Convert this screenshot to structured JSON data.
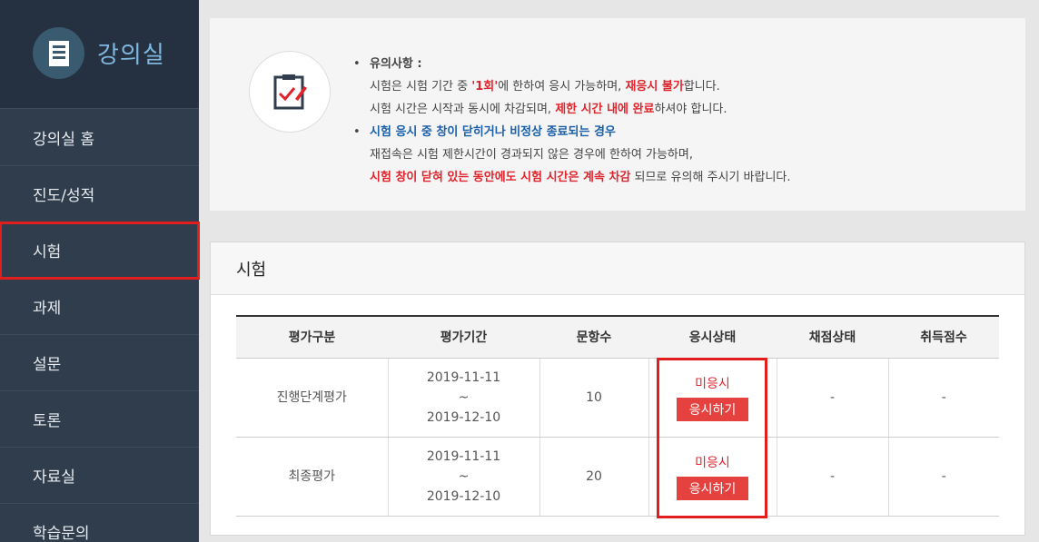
{
  "sidebar": {
    "title": "강의실",
    "items": [
      {
        "label": "강의실 홈"
      },
      {
        "label": "진도/성적"
      },
      {
        "label": "시험"
      },
      {
        "label": "과제"
      },
      {
        "label": "설문"
      },
      {
        "label": "토론"
      },
      {
        "label": "자료실"
      },
      {
        "label": "학습문의"
      }
    ]
  },
  "notice": {
    "heading": "유의사항 :",
    "line1_a": "시험은 시험 기간 중 ",
    "line1_b": "'1회'",
    "line1_c": "에 한하여 응시 가능하며, ",
    "line1_d": "재응시 불가",
    "line1_e": "합니다.",
    "line2_a": "시험 시간은 시작과 동시에 차감되며, ",
    "line2_b": "제한 시간 내에 완료",
    "line2_c": "하셔야 합니다.",
    "line3": "시험 응시 중 창이 닫히거나 비정상 종료되는 경우",
    "line4": "재접속은 시험 제한시간이 경과되지 않은 경우에 한하여 가능하며,",
    "line5_a": "시험 창이 닫혀 있는 동안에도 시험 시간은 계속 차감",
    "line5_b": " 되므로 유의해 주시기 바랍니다."
  },
  "exam": {
    "title": "시험",
    "columns": [
      "평가구분",
      "평가기간",
      "문항수",
      "응시상태",
      "채점상태",
      "취득점수"
    ],
    "rows": [
      {
        "type": "진행단계평가",
        "start": "2019-11-11",
        "sep": "~",
        "end": "2019-12-10",
        "count": "10",
        "status": "미응시",
        "button": "응시하기",
        "grading": "-",
        "score": "-"
      },
      {
        "type": "최종평가",
        "start": "2019-11-11",
        "sep": "~",
        "end": "2019-12-10",
        "count": "20",
        "status": "미응시",
        "button": "응시하기",
        "grading": "-",
        "score": "-"
      }
    ]
  },
  "colors": {
    "sidebar": "#2f3d4c",
    "accent_red": "#e0242c",
    "accent_blue": "#1b5fa8"
  }
}
